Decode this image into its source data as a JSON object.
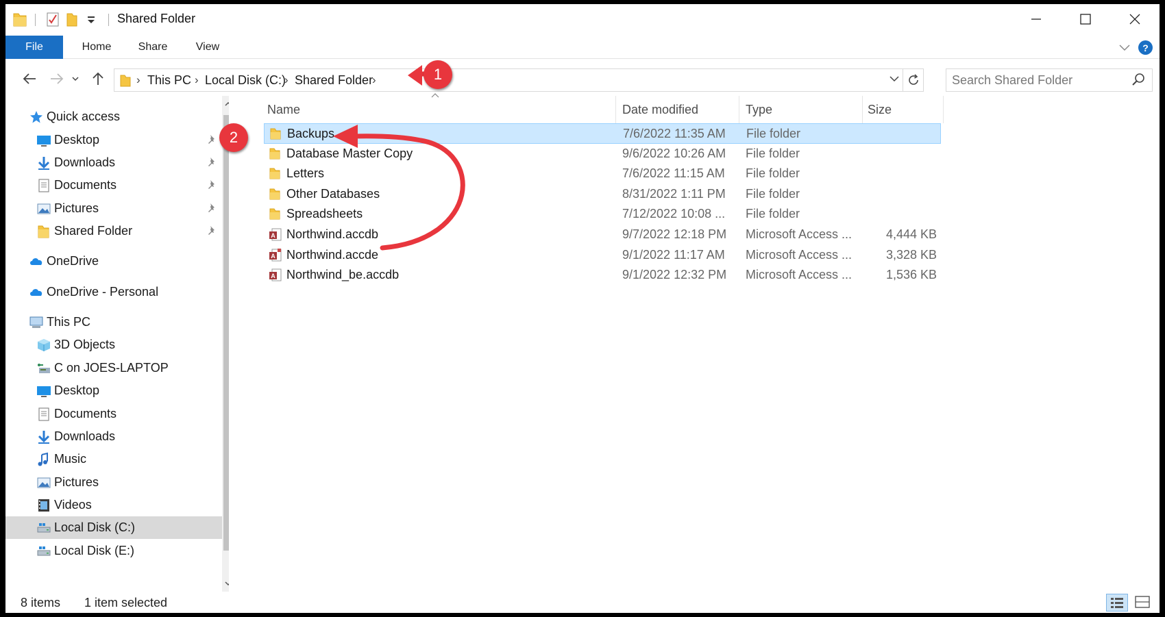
{
  "window": {
    "title": "Shared Folder",
    "controls": {
      "minimize": "—",
      "maximize": "☐",
      "close": "✕"
    }
  },
  "ribbon": {
    "tabs": [
      {
        "label": "File"
      },
      {
        "label": "Home"
      },
      {
        "label": "Share"
      },
      {
        "label": "View"
      }
    ],
    "help": "?"
  },
  "address": {
    "crumbs": [
      "This PC",
      "Local Disk (C:)",
      "Shared Folder"
    ],
    "search_placeholder": "Search Shared Folder"
  },
  "nav": {
    "items": [
      {
        "label": "Quick access",
        "icon": "star-icon",
        "group": true
      },
      {
        "label": "Desktop",
        "icon": "desktop-icon",
        "pinned": true
      },
      {
        "label": "Downloads",
        "icon": "download-icon",
        "pinned": true
      },
      {
        "label": "Documents",
        "icon": "documents-icon",
        "pinned": true
      },
      {
        "label": "Pictures",
        "icon": "pictures-icon",
        "pinned": true
      },
      {
        "label": "Shared Folder",
        "icon": "folder-icon",
        "pinned": true
      },
      {
        "label": "OneDrive",
        "icon": "cloud-icon",
        "group": true
      },
      {
        "label": "OneDrive - Personal",
        "icon": "cloud-icon",
        "group": true
      },
      {
        "label": "This PC",
        "icon": "computer-icon",
        "group": true
      },
      {
        "label": "3D Objects",
        "icon": "cube-icon"
      },
      {
        "label": "C on JOES-LAPTOP",
        "icon": "network-drive-icon"
      },
      {
        "label": "Desktop",
        "icon": "desktop-icon"
      },
      {
        "label": "Documents",
        "icon": "documents-icon"
      },
      {
        "label": "Downloads",
        "icon": "download-icon"
      },
      {
        "label": "Music",
        "icon": "music-icon"
      },
      {
        "label": "Pictures",
        "icon": "pictures-icon"
      },
      {
        "label": "Videos",
        "icon": "video-icon"
      },
      {
        "label": "Local Disk (C:)",
        "icon": "disk-icon",
        "selected": true
      },
      {
        "label": "Local Disk (E:)",
        "icon": "disk-icon"
      }
    ]
  },
  "list": {
    "columns": {
      "name": "Name",
      "date": "Date modified",
      "type": "Type",
      "size": "Size"
    },
    "rows": [
      {
        "name": "Backups",
        "date": "7/6/2022 11:35 AM",
        "type": "File folder",
        "size": "",
        "kind": "folder",
        "selected": true
      },
      {
        "name": "Database Master Copy",
        "date": "9/6/2022 10:26 AM",
        "type": "File folder",
        "size": "",
        "kind": "folder"
      },
      {
        "name": "Letters",
        "date": "7/6/2022 11:15 AM",
        "type": "File folder",
        "size": "",
        "kind": "folder"
      },
      {
        "name": "Other Databases",
        "date": "8/31/2022 1:11 PM",
        "type": "File folder",
        "size": "",
        "kind": "folder"
      },
      {
        "name": "Spreadsheets",
        "date": "7/12/2022 10:08 ...",
        "type": "File folder",
        "size": "",
        "kind": "folder"
      },
      {
        "name": "Northwind.accdb",
        "date": "9/7/2022 12:18 PM",
        "type": "Microsoft Access ...",
        "size": "4,444 KB",
        "kind": "access"
      },
      {
        "name": "Northwind.accde",
        "date": "9/1/2022 11:17 AM",
        "type": "Microsoft Access ...",
        "size": "3,328 KB",
        "kind": "access-exe"
      },
      {
        "name": "Northwind_be.accdb",
        "date": "9/1/2022 12:32 PM",
        "type": "Microsoft Access ...",
        "size": "1,536 KB",
        "kind": "access"
      }
    ]
  },
  "status": {
    "count": "8 items",
    "selection": "1 item selected"
  },
  "annotations": {
    "badge1": "1",
    "badge2": "2",
    "color": "#e8363d"
  }
}
